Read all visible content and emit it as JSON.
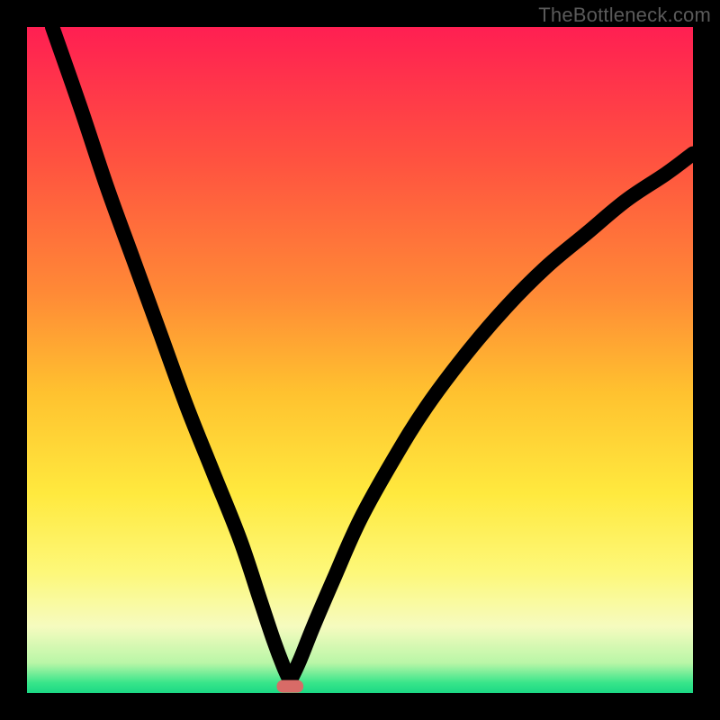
{
  "watermark": "TheBottleneck.com",
  "chart_data": {
    "type": "line",
    "title": "",
    "xlabel": "",
    "ylabel": "",
    "xlim": [
      0,
      100
    ],
    "ylim": [
      0,
      100
    ],
    "grid": false,
    "legend": false,
    "background_gradient": {
      "stops": [
        {
          "offset": 0.0,
          "color": "#ff1f52"
        },
        {
          "offset": 0.2,
          "color": "#ff5240"
        },
        {
          "offset": 0.4,
          "color": "#ff8a36"
        },
        {
          "offset": 0.55,
          "color": "#ffc22f"
        },
        {
          "offset": 0.7,
          "color": "#ffe93e"
        },
        {
          "offset": 0.82,
          "color": "#fdf87a"
        },
        {
          "offset": 0.9,
          "color": "#f6fbbf"
        },
        {
          "offset": 0.955,
          "color": "#b9f6a7"
        },
        {
          "offset": 0.985,
          "color": "#37e58a"
        },
        {
          "offset": 1.0,
          "color": "#1bd884"
        }
      ]
    },
    "marker": {
      "x": 39.5,
      "y": 1.0,
      "shape": "rounded-rect",
      "color": "#d86b67"
    },
    "series": [
      {
        "name": "left-branch",
        "x": [
          3.8,
          8,
          12,
          16,
          20,
          24,
          28,
          32,
          35,
          37,
          38.5,
          39.5
        ],
        "y": [
          100,
          88,
          76,
          65,
          54,
          43,
          33,
          23,
          14,
          8,
          4,
          1.8
        ]
      },
      {
        "name": "right-branch",
        "x": [
          39.5,
          41,
          43,
          46,
          50,
          55,
          60,
          66,
          72,
          78,
          84,
          90,
          96,
          100
        ],
        "y": [
          1.8,
          5,
          10,
          17,
          26,
          35,
          43,
          51,
          58,
          64,
          69,
          74,
          78,
          81
        ]
      }
    ]
  }
}
